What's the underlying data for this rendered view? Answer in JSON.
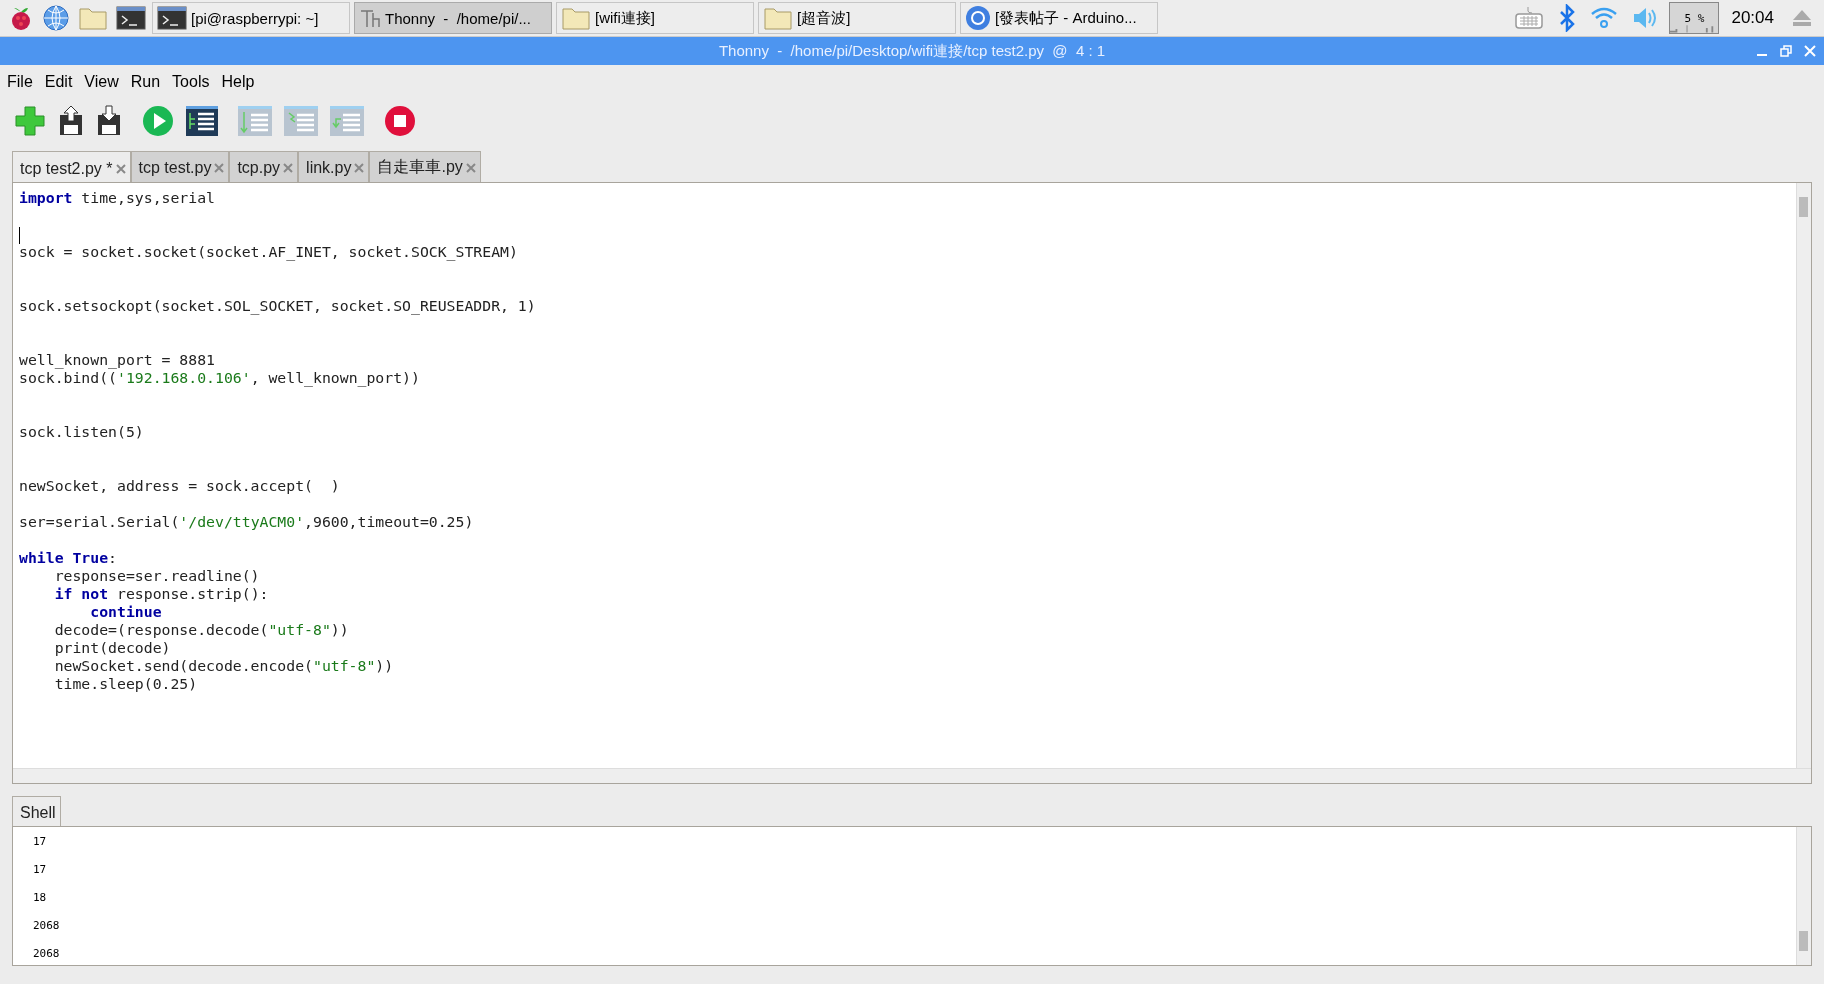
{
  "taskbar": {
    "launchers": [
      {
        "kind": "raspberry"
      },
      {
        "kind": "globe"
      },
      {
        "kind": "folder"
      },
      {
        "kind": "terminal"
      }
    ],
    "windows": [
      {
        "kind": "terminal",
        "label": "[pi@raspberrypi: ~]",
        "selected": false
      },
      {
        "kind": "thonny",
        "label": "Thonny  -  /home/pi/...",
        "selected": true
      },
      {
        "kind": "folder",
        "label": "[wifi連接]",
        "selected": false
      },
      {
        "kind": "folder",
        "label": "[超音波]",
        "selected": false
      },
      {
        "kind": "browser",
        "label": "[發表帖子 - Arduino...",
        "selected": false
      }
    ],
    "cpu_reading": "5 %",
    "clock": "20:04"
  },
  "window": {
    "title": "Thonny  -  /home/pi/Desktop/wifi連接/tcp test2.py  @  4 : 1"
  },
  "menu": [
    "File",
    "Edit",
    "View",
    "Run",
    "Tools",
    "Help"
  ],
  "toolbar": [
    {
      "kind": "new"
    },
    {
      "kind": "load"
    },
    {
      "kind": "save"
    },
    {
      "kind": "run"
    },
    {
      "kind": "debug"
    },
    {
      "kind": "step-over"
    },
    {
      "kind": "step-into"
    },
    {
      "kind": "step-out"
    },
    {
      "kind": "stop"
    }
  ],
  "tabs": [
    {
      "label": "tcp test2.py *",
      "selected": true
    },
    {
      "label": "tcp test.py",
      "selected": false
    },
    {
      "label": "tcp.py",
      "selected": false
    },
    {
      "label": "link.py",
      "selected": false
    },
    {
      "label": "自走車車.py",
      "selected": false
    }
  ],
  "code": [
    {
      "kind": "code",
      "tokens": [
        {
          "text": "import",
          "kind": "keyword"
        },
        {
          "text": " time,sys,serial",
          "kind": "plain"
        }
      ]
    },
    {
      "kind": "blank"
    },
    {
      "kind": "blank",
      "cursor": true
    },
    {
      "kind": "code",
      "tokens": [
        {
          "text": "sock = socket.socket(socket.AF_INET, socket.SOCK_STREAM)",
          "kind": "plain"
        }
      ]
    },
    {
      "kind": "blank"
    },
    {
      "kind": "blank"
    },
    {
      "kind": "code",
      "tokens": [
        {
          "text": "sock.setsockopt(socket.SOL_SOCKET, socket.SO_REUSEADDR, 1)",
          "kind": "plain"
        }
      ]
    },
    {
      "kind": "blank"
    },
    {
      "kind": "blank"
    },
    {
      "kind": "code",
      "tokens": [
        {
          "text": "well_known_port = 8881",
          "kind": "plain"
        }
      ]
    },
    {
      "kind": "code",
      "tokens": [
        {
          "text": "sock.bind((",
          "kind": "plain"
        },
        {
          "text": "'192.168.0.106'",
          "kind": "string"
        },
        {
          "text": ", well_known_port))",
          "kind": "plain"
        }
      ]
    },
    {
      "kind": "blank"
    },
    {
      "kind": "blank"
    },
    {
      "kind": "code",
      "tokens": [
        {
          "text": "sock.listen(5)",
          "kind": "plain"
        }
      ]
    },
    {
      "kind": "blank"
    },
    {
      "kind": "blank"
    },
    {
      "kind": "code",
      "tokens": [
        {
          "text": "newSocket, address = sock.accept(  )",
          "kind": "plain"
        }
      ]
    },
    {
      "kind": "blank"
    },
    {
      "kind": "code",
      "tokens": [
        {
          "text": "ser=serial.Serial(",
          "kind": "plain"
        },
        {
          "text": "'/dev/ttyACM0'",
          "kind": "string"
        },
        {
          "text": ",9600,timeout=0.25)",
          "kind": "plain"
        }
      ]
    },
    {
      "kind": "blank"
    },
    {
      "kind": "code",
      "tokens": [
        {
          "text": "while True",
          "kind": "keyword"
        },
        {
          "text": ":",
          "kind": "plain"
        }
      ]
    },
    {
      "kind": "code",
      "tokens": [
        {
          "text": "    response=ser.readline()",
          "kind": "plain"
        }
      ]
    },
    {
      "kind": "code",
      "tokens": [
        {
          "text": "    if not",
          "kind": "keyword"
        },
        {
          "text": " response.strip():",
          "kind": "plain"
        }
      ]
    },
    {
      "kind": "code",
      "tokens": [
        {
          "text": "        continue",
          "kind": "keyword"
        }
      ]
    },
    {
      "kind": "code",
      "tokens": [
        {
          "text": "    decode=(response.decode(",
          "kind": "plain"
        },
        {
          "text": "\"utf-8\"",
          "kind": "string"
        },
        {
          "text": "))",
          "kind": "plain"
        }
      ]
    },
    {
      "kind": "code",
      "tokens": [
        {
          "text": "    print(decode)",
          "kind": "plain"
        }
      ]
    },
    {
      "kind": "code",
      "tokens": [
        {
          "text": "    newSocket.send(decode.encode(",
          "kind": "plain"
        },
        {
          "text": "\"utf-8\"",
          "kind": "string"
        },
        {
          "text": "))",
          "kind": "plain"
        }
      ]
    },
    {
      "kind": "code",
      "tokens": [
        {
          "text": "    time.sleep(0.25)",
          "kind": "plain"
        }
      ]
    }
  ],
  "shell": {
    "tab": "Shell",
    "lines": [
      "17",
      "17",
      "18",
      "2068",
      "2068"
    ]
  }
}
